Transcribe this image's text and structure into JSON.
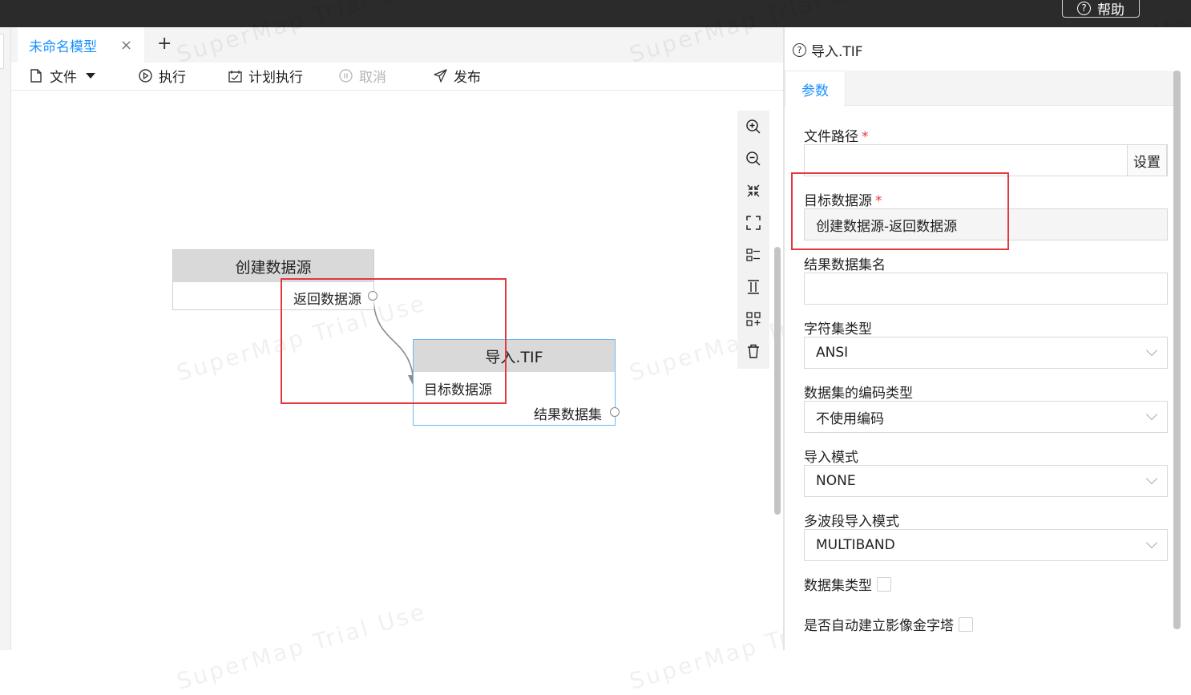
{
  "topbar": {
    "help_label": "帮助"
  },
  "tabs": [
    {
      "label": "未命名模型",
      "close": "×"
    }
  ],
  "tab_add": "+",
  "toolbar": {
    "file": "文件",
    "execute": "执行",
    "schedule": "计划执行",
    "cancel": "取消",
    "publish": "发布"
  },
  "nodes": {
    "create_ds": {
      "title": "创建数据源",
      "output": "返回数据源"
    },
    "import_tif": {
      "title": "导入.TIF",
      "input": "目标数据源",
      "output": "结果数据集"
    }
  },
  "watermark": "SuperMap Trial Use",
  "panel": {
    "title": "导入.TIF",
    "tab": "参数",
    "fields": {
      "file_path": {
        "label": "文件路径",
        "required": "*",
        "value": "",
        "button": "设置"
      },
      "target_ds": {
        "label": "目标数据源",
        "required": "*",
        "value": "创建数据源-返回数据源"
      },
      "result_name": {
        "label": "结果数据集名",
        "value": ""
      },
      "charset": {
        "label": "字符集类型",
        "value": "ANSI"
      },
      "encoding": {
        "label": "数据集的编码类型",
        "value": "不使用编码"
      },
      "import_mode": {
        "label": "导入模式",
        "value": "NONE"
      },
      "multiband_mode": {
        "label": "多波段导入模式",
        "value": "MULTIBAND"
      },
      "dataset_type": {
        "label": "数据集类型",
        "checked": false
      },
      "build_pyramid": {
        "label": "是否自动建立影像金字塔",
        "checked": false
      }
    }
  },
  "colors": {
    "accent": "#1890ff",
    "highlight": "#e0393e",
    "topbar": "#2b2b2b"
  }
}
